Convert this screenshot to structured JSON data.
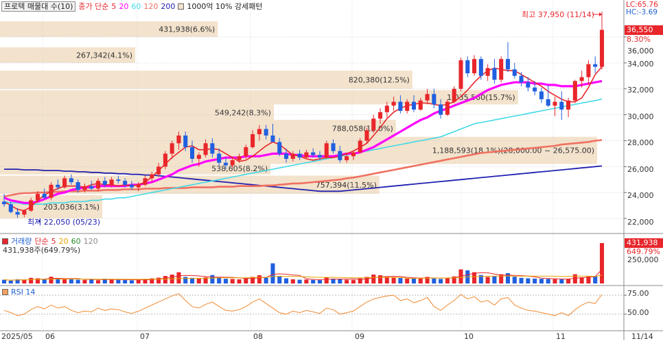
{
  "legend": {
    "title": "프로텍 매물대 수(10)",
    "ma_label": "종가 단순",
    "ma_periods": [
      "5",
      "20",
      "60",
      "120",
      "200"
    ],
    "ma_colors": [
      "#e8262b",
      "#ff00ff",
      "#3fd9e6",
      "#f07060",
      "#2020b0"
    ],
    "volume_profile_label": "1000억 10% 강세패턴",
    "volume_profile_color": "#f3e2cc"
  },
  "indicators": {
    "lc": "LC:65.76",
    "hc": "HC:-3.69"
  },
  "current": {
    "price": "36,550",
    "change": "8.30%"
  },
  "annotations": {
    "high": "최고 37,950 (11/14)",
    "low": "최저 22,050 (05/23)"
  },
  "price_axis": [
    "36,000",
    "34,000",
    "32,000",
    "30,000",
    "28,000",
    "26,000",
    "24,000",
    "22,000"
  ],
  "volume_panel": {
    "legend_label": "거래량",
    "ma_label": "단순",
    "ma_periods": [
      "5",
      "20",
      "60",
      "120"
    ],
    "ma_colors": [
      "#e8262b",
      "#e6a200",
      "#2a8a2a",
      "#888888"
    ],
    "volume_text": "431,938주(649.79%)",
    "badge_value": "431,938",
    "badge_change": "649.79%",
    "axis": [
      "250,000"
    ]
  },
  "rsi_panel": {
    "label": "RSI 14",
    "axis": [
      "75.00",
      "50.00"
    ]
  },
  "x_axis": {
    "labels": [
      "2025/05",
      "06",
      "07",
      "08",
      "09",
      "10",
      "11"
    ],
    "end_label": "11/14"
  },
  "chart_data": {
    "type": "candlestick",
    "y_range": [
      21000,
      37900
    ],
    "last_close": 36550,
    "high": {
      "value": 37950,
      "date": "11/14"
    },
    "low": {
      "value": 22050,
      "date": "05/23"
    },
    "volume_profile": [
      {
        "range": [
          36000,
          37200
        ],
        "label": "431,938(6.6%)",
        "share": 6.6
      },
      {
        "range": [
          34000,
          35200
        ],
        "label": "267,342(4.1%)",
        "share": 4.1
      },
      {
        "range": [
          32000,
          33400
        ],
        "label": "820,380(12.5%)",
        "share": 12.5
      },
      {
        "range": [
          30800,
          31900
        ],
        "label": "1,035,560(15.7%)",
        "share": 15.7
      },
      {
        "range": [
          29500,
          30800
        ],
        "label": "549,242(8.3%)",
        "share": 8.3
      },
      {
        "range": [
          28300,
          29600
        ],
        "label": "788,058(12.0%)",
        "share": 12.0
      },
      {
        "range": [
          26200,
          28300
        ],
        "label": "1,188,593(18.1%)(28,000.00 ~ 26,575.00)",
        "share": 18.1
      },
      {
        "range": [
          25400,
          26300
        ],
        "label": "538,605(8.2%)",
        "share": 8.2
      },
      {
        "range": [
          23900,
          25300
        ],
        "label": "757,394(11.5%)",
        "share": 11.5
      },
      {
        "range": [
          22000,
          23800
        ],
        "label": "203,036(3.1%)",
        "share": 3.1
      }
    ],
    "series": [
      {
        "name": "5",
        "values": [
          23300,
          23000,
          22700,
          22600,
          22900,
          23400,
          23800,
          24100,
          24300,
          24500,
          24500,
          24500,
          24400,
          24600,
          24700,
          24600,
          24600,
          24500,
          24600,
          24500,
          24600,
          24800,
          25200,
          25700,
          26200,
          26700,
          27100,
          27500,
          27600,
          27300,
          27300,
          27400,
          27300,
          27000,
          26700,
          26400,
          26500,
          26800,
          27200,
          27600,
          27900,
          27700,
          27300,
          26900,
          26800,
          26600,
          26500,
          26600,
          26700,
          26700,
          26800,
          27000,
          27200,
          27500,
          27800,
          28400,
          29000,
          29700,
          30200,
          30500,
          30700,
          30800,
          30900,
          30900,
          30800,
          30700,
          30800,
          31000,
          31400,
          31900,
          32500,
          33000,
          33400,
          33600,
          33500,
          33400,
          33400,
          33100,
          32800,
          32500,
          32200,
          31800,
          31500,
          31200,
          31000,
          31000,
          31300,
          32100,
          33100,
          33700
        ]
      },
      {
        "name": "20",
        "values": [
          23600,
          23400,
          23300,
          23200,
          23200,
          23300,
          23500,
          23700,
          23900,
          24000,
          24200,
          24300,
          24400,
          24400,
          24500,
          24500,
          24500,
          24500,
          24500,
          24600,
          24600,
          24700,
          24800,
          25000,
          25200,
          25400,
          25700,
          25900,
          26100,
          26200,
          26400,
          26500,
          26600,
          26700,
          26700,
          26700,
          26800,
          26800,
          26800,
          26900,
          27000,
          27000,
          27000,
          26900,
          26900,
          26800,
          26800,
          26800,
          26800,
          26800,
          26900,
          27000,
          27000,
          27100,
          27300,
          27500,
          27800,
          28100,
          28400,
          28700,
          29000,
          29300,
          29600,
          29800,
          30100,
          30300,
          30500,
          30700,
          30900,
          31100,
          31300,
          31600,
          31900,
          32100,
          32300,
          32400,
          32500,
          32500,
          32500,
          32400,
          32400,
          32300,
          32300,
          32200,
          32200,
          32200,
          32300,
          32400,
          32500,
          32600
        ]
      },
      {
        "name": "60",
        "values": [
          23300,
          23200,
          23200,
          23100,
          23100,
          23100,
          23100,
          23200,
          23200,
          23200,
          23300,
          23300,
          23300,
          23400,
          23400,
          23500,
          23500,
          23600,
          23600,
          23700,
          23800,
          23900,
          24000,
          24100,
          24200,
          24300,
          24400,
          24500,
          24600,
          24700,
          24800,
          24900,
          25000,
          25100,
          25200,
          25300,
          25400,
          25500,
          25600,
          25700,
          25800,
          25900,
          26000,
          26100,
          26200,
          26300,
          26400,
          26500,
          26600,
          26700,
          26800,
          26900,
          27000,
          27100,
          27200,
          27300,
          27400,
          27500,
          27600,
          27700,
          27800,
          27900,
          28000,
          28100,
          28200,
          28300,
          28500,
          28700,
          28900,
          29100,
          29300,
          29400,
          29500,
          29600,
          29700,
          29800,
          29900,
          30000,
          30100,
          30200,
          30300,
          30400,
          30500,
          30600,
          30700,
          30800,
          30900,
          31000,
          31100,
          31200
        ]
      },
      {
        "name": "120",
        "values": [
          23700,
          23800,
          23900,
          23950,
          23950,
          24000,
          24000,
          24050,
          24050,
          24100,
          24100,
          24100,
          24150,
          24150,
          24150,
          24200,
          24200,
          24200,
          24250,
          24250,
          24250,
          24300,
          24300,
          24300,
          24350,
          24350,
          24350,
          24350,
          24400,
          24400,
          24400,
          24400,
          24450,
          24450,
          24450,
          24500,
          24500,
          24500,
          24500,
          24550,
          24550,
          24600,
          24650,
          24700,
          24700,
          24750,
          24800,
          24850,
          24900,
          24950,
          25000,
          25100,
          25150,
          25250,
          25350,
          25450,
          25550,
          25650,
          25750,
          25850,
          25950,
          26050,
          26150,
          26250,
          26350,
          26450,
          26550,
          26650,
          26750,
          26850,
          26950,
          27050,
          27100,
          27150,
          27200,
          27250,
          27300,
          27350,
          27400,
          27450,
          27500,
          27550,
          27600,
          27700,
          27750,
          27800,
          27850,
          27900,
          28000,
          28050
        ]
      },
      {
        "name": "200",
        "values": [
          25800,
          25800,
          25800,
          25750,
          25750,
          25750,
          25700,
          25700,
          25700,
          25650,
          25650,
          25600,
          25600,
          25550,
          25550,
          25500,
          25500,
          25450,
          25450,
          25400,
          25400,
          25350,
          25350,
          25300,
          25250,
          25200,
          25150,
          25100,
          25050,
          25000,
          24950,
          24900,
          24850,
          24800,
          24750,
          24700,
          24650,
          24600,
          24550,
          24500,
          24450,
          24400,
          24350,
          24300,
          24250,
          24200,
          24150,
          24100,
          24100,
          24100,
          24100,
          24150,
          24200,
          24250,
          24300,
          24350,
          24400,
          24450,
          24500,
          24550,
          24600,
          24650,
          24700,
          24750,
          24800,
          24850,
          24900,
          24950,
          25000,
          25050,
          25100,
          25150,
          25200,
          25250,
          25300,
          25350,
          25400,
          25450,
          25500,
          25550,
          25600,
          25650,
          25700,
          25750,
          25800,
          25850,
          25900,
          25950,
          26000,
          26050
        ]
      }
    ],
    "candles": [
      [
        23300,
        23900,
        22900,
        23100
      ],
      [
        23100,
        23300,
        22400,
        22500
      ],
      [
        22500,
        22800,
        22050,
        22300
      ],
      [
        22300,
        22700,
        22100,
        22600
      ],
      [
        22600,
        23600,
        22500,
        23400
      ],
      [
        23400,
        24100,
        23200,
        23900
      ],
      [
        23900,
        24300,
        23500,
        23600
      ],
      [
        23600,
        24800,
        23400,
        24600
      ],
      [
        24600,
        25000,
        24200,
        24400
      ],
      [
        24400,
        25300,
        24300,
        25100
      ],
      [
        25100,
        25400,
        24600,
        24800
      ],
      [
        24800,
        25000,
        24000,
        24200
      ],
      [
        24200,
        24700,
        24000,
        24500
      ],
      [
        24500,
        24900,
        24200,
        24300
      ],
      [
        24300,
        25100,
        24100,
        24900
      ],
      [
        24900,
        25200,
        24400,
        24600
      ],
      [
        24600,
        25200,
        24400,
        25000
      ],
      [
        25000,
        25300,
        24700,
        24900
      ],
      [
        24900,
        25100,
        24400,
        24600
      ],
      [
        24600,
        24900,
        24200,
        24400
      ],
      [
        24400,
        24800,
        24100,
        24600
      ],
      [
        24600,
        25300,
        24500,
        25100
      ],
      [
        25100,
        25600,
        24800,
        25400
      ],
      [
        25400,
        26300,
        25200,
        26000
      ],
      [
        26000,
        27200,
        25800,
        27000
      ],
      [
        27000,
        28000,
        26600,
        27800
      ],
      [
        27800,
        28700,
        27300,
        28400
      ],
      [
        28400,
        28700,
        27200,
        27500
      ],
      [
        27500,
        28000,
        26300,
        26600
      ],
      [
        26600,
        27100,
        26000,
        26900
      ],
      [
        26900,
        28100,
        26700,
        27800
      ],
      [
        27800,
        28200,
        26700,
        27000
      ],
      [
        27000,
        27400,
        26100,
        26300
      ],
      [
        26300,
        26700,
        25800,
        26100
      ],
      [
        26100,
        26700,
        25900,
        26500
      ],
      [
        26500,
        27000,
        26300,
        26800
      ],
      [
        26800,
        27700,
        26600,
        27500
      ],
      [
        27500,
        28800,
        27400,
        28500
      ],
      [
        28500,
        29200,
        28000,
        28900
      ],
      [
        28900,
        29200,
        28100,
        28400
      ],
      [
        28400,
        29300,
        27900,
        27900
      ],
      [
        27900,
        28200,
        26800,
        27000
      ],
      [
        27000,
        27400,
        26300,
        26600
      ],
      [
        26600,
        27200,
        26400,
        27000
      ],
      [
        27000,
        27300,
        26500,
        26700
      ],
      [
        26700,
        27300,
        26600,
        27100
      ],
      [
        27100,
        27400,
        26700,
        26900
      ],
      [
        26900,
        27200,
        26500,
        26700
      ],
      [
        26700,
        28000,
        26600,
        27800
      ],
      [
        27800,
        28100,
        27000,
        27200
      ],
      [
        27200,
        27600,
        26300,
        26500
      ],
      [
        26500,
        27000,
        26300,
        26800
      ],
      [
        26800,
        27200,
        26500,
        27100
      ],
      [
        27100,
        28200,
        27000,
        28000
      ],
      [
        28000,
        29000,
        27800,
        28800
      ],
      [
        28800,
        30000,
        28600,
        29700
      ],
      [
        29700,
        30500,
        29300,
        30200
      ],
      [
        30200,
        31000,
        29800,
        30700
      ],
      [
        30700,
        31400,
        30300,
        31000
      ],
      [
        31000,
        31500,
        30100,
        30300
      ],
      [
        30300,
        31200,
        30100,
        31000
      ],
      [
        31000,
        31500,
        30200,
        30400
      ],
      [
        30400,
        31300,
        30300,
        31100
      ],
      [
        31100,
        32000,
        30800,
        31600
      ],
      [
        31600,
        32000,
        30500,
        30800
      ],
      [
        30800,
        31200,
        29700,
        30000
      ],
      [
        30000,
        31200,
        29900,
        31000
      ],
      [
        31000,
        32200,
        30900,
        32000
      ],
      [
        32000,
        34400,
        31800,
        34200
      ],
      [
        34200,
        34500,
        32900,
        33200
      ],
      [
        33200,
        34600,
        33000,
        34300
      ],
      [
        34300,
        34500,
        32700,
        33000
      ],
      [
        33000,
        33900,
        32600,
        33600
      ],
      [
        33600,
        34300,
        32400,
        32700
      ],
      [
        32700,
        34500,
        32500,
        34300
      ],
      [
        34300,
        35600,
        33300,
        33500
      ],
      [
        33500,
        34000,
        32800,
        33000
      ],
      [
        33000,
        33300,
        32200,
        32500
      ],
      [
        32500,
        32900,
        31800,
        32100
      ],
      [
        32100,
        32600,
        31500,
        31800
      ],
      [
        31800,
        32100,
        30900,
        31200
      ],
      [
        31200,
        32300,
        30600,
        30700
      ],
      [
        30700,
        31400,
        29900,
        31000
      ],
      [
        31000,
        31800,
        29600,
        30400
      ],
      [
        30400,
        31300,
        29800,
        31100
      ],
      [
        31100,
        32700,
        30900,
        32600
      ],
      [
        32600,
        33400,
        32100,
        32900
      ],
      [
        32900,
        34200,
        32300,
        33900
      ],
      [
        33900,
        34500,
        33200,
        33700
      ],
      [
        33700,
        37950,
        33500,
        36550
      ]
    ],
    "volume": [
      40,
      30,
      45,
      38,
      60,
      55,
      40,
      72,
      50,
      44,
      52,
      40,
      38,
      46,
      35,
      50,
      42,
      38,
      36,
      34,
      40,
      48,
      55,
      62,
      80,
      95,
      120,
      70,
      60,
      55,
      66,
      90,
      70,
      50,
      48,
      44,
      58,
      70,
      88,
      62,
      215,
      75,
      55,
      45,
      40,
      42,
      38,
      36,
      66,
      52,
      44,
      40,
      38,
      55,
      70,
      95,
      88,
      70,
      62,
      58,
      52,
      56,
      60,
      70,
      54,
      48,
      60,
      75,
      150,
      140,
      120,
      90,
      70,
      80,
      98,
      110,
      72,
      60,
      55,
      52,
      50,
      48,
      46,
      44,
      50,
      98,
      66,
      75,
      80,
      431
    ],
    "rsi": [
      55,
      52,
      48,
      50,
      56,
      60,
      57,
      62,
      58,
      60,
      55,
      52,
      54,
      53,
      58,
      55,
      57,
      56,
      53,
      51,
      54,
      58,
      62,
      66,
      70,
      74,
      77,
      68,
      60,
      58,
      63,
      66,
      60,
      55,
      54,
      56,
      60,
      66,
      70,
      64,
      58,
      52,
      50,
      54,
      52,
      55,
      53,
      51,
      58,
      56,
      50,
      52,
      54,
      60,
      66,
      70,
      72,
      74,
      75,
      68,
      70,
      65,
      68,
      72,
      60,
      55,
      62,
      68,
      76,
      70,
      73,
      66,
      68,
      62,
      70,
      72,
      62,
      58,
      55,
      54,
      52,
      50,
      48,
      52,
      48,
      56,
      62,
      66,
      64,
      76
    ],
    "rsi_levels": [
      75,
      50
    ]
  }
}
